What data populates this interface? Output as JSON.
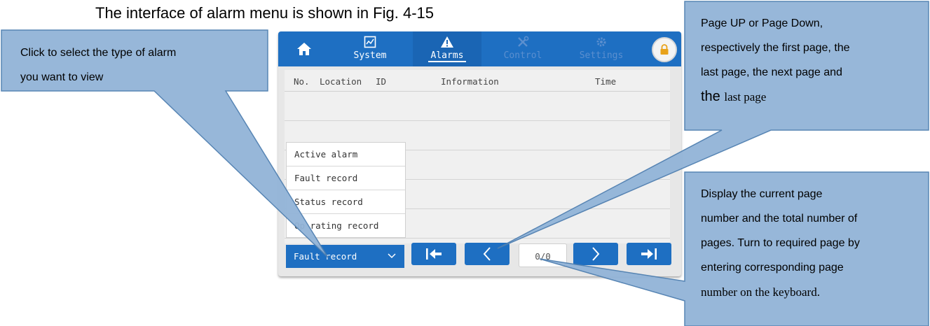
{
  "caption": "The interface of alarm menu is shown in Fig. 4-15",
  "navbar": {
    "home_icon": "home-icon",
    "tabs": [
      {
        "label": "System",
        "icon": "chart-icon"
      },
      {
        "label": "Alarms",
        "icon": "warning-icon"
      },
      {
        "label": "Control",
        "icon": "tools-icon"
      },
      {
        "label": "Settings",
        "icon": "gear-icon"
      }
    ],
    "lock_icon": "lock-icon"
  },
  "table": {
    "headers": [
      "No.",
      "Location",
      "ID",
      "Information",
      "Time"
    ]
  },
  "alarm_type_menu": {
    "options": [
      "Active alarm",
      "Fault record",
      "Status record",
      "Operating record"
    ],
    "visible_options": [
      "Active alarm",
      "Fault record",
      "Status record",
      "Op",
      "rating record"
    ],
    "selected": "Fault record",
    "selected_visible": [
      "Fault ",
      "record"
    ]
  },
  "pagination": {
    "page_display": "0/0"
  },
  "callouts": {
    "left": {
      "lines": [
        "Click to select the type of alarm",
        "you want to view"
      ]
    },
    "top_right": {
      "lines": [
        "Page UP or Page Down,",
        "respectively the first page, the",
        "last page, the next page and"
      ],
      "last_line_a": "the ",
      "last_line_b": "last page"
    },
    "bottom_right": {
      "lines": [
        "Display the current page",
        "number and the total number of",
        "pages. Turn to required page by",
        "entering corresponding page"
      ],
      "last_line": "number on the keyboard."
    }
  },
  "colors": {
    "nav_blue": "#1e6fc2",
    "callout_fill": "#92b4d8",
    "callout_border": "#4f7fb0"
  }
}
